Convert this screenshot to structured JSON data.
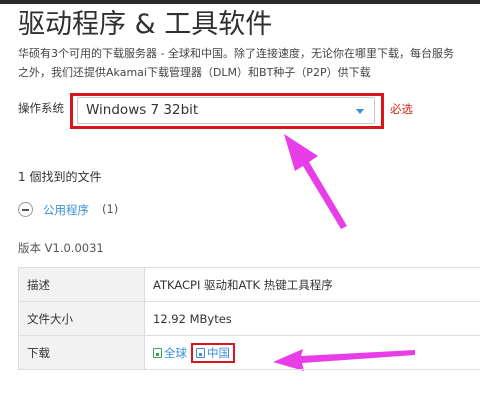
{
  "header": {
    "title": "驱动程序 & 工具软件"
  },
  "description": {
    "line1": "华硕有3个可用的下载服务器 - 全球和中国。除了连接速度，无论你在哪里下载，每台服务",
    "line2": "之外，我们还提供Akamai下载管理器（DLM）和BT种子（P2P）供下载"
  },
  "os_selector": {
    "label": "操作系统",
    "selected": "Windows 7 32bit",
    "required_note": "必选"
  },
  "results": {
    "found_count": "1 個找到的文件",
    "category_label": "公用程序",
    "category_count": "(1)",
    "version": "版本 V1.0.0031"
  },
  "file_table": {
    "rows": [
      {
        "key": "描述",
        "value": "ATKACPI 驱动和ATK 热键工具程序"
      },
      {
        "key": "文件大小",
        "value": "12.92 MBytes"
      },
      {
        "key": "下载",
        "value": ""
      }
    ],
    "download_global": "全球",
    "download_china": "中国"
  },
  "annotations": {
    "highlight_color": "#d8161c",
    "arrow_color": "#e83ee8"
  },
  "colors": {
    "link": "#3a8fd8",
    "required": "#d9261c"
  }
}
